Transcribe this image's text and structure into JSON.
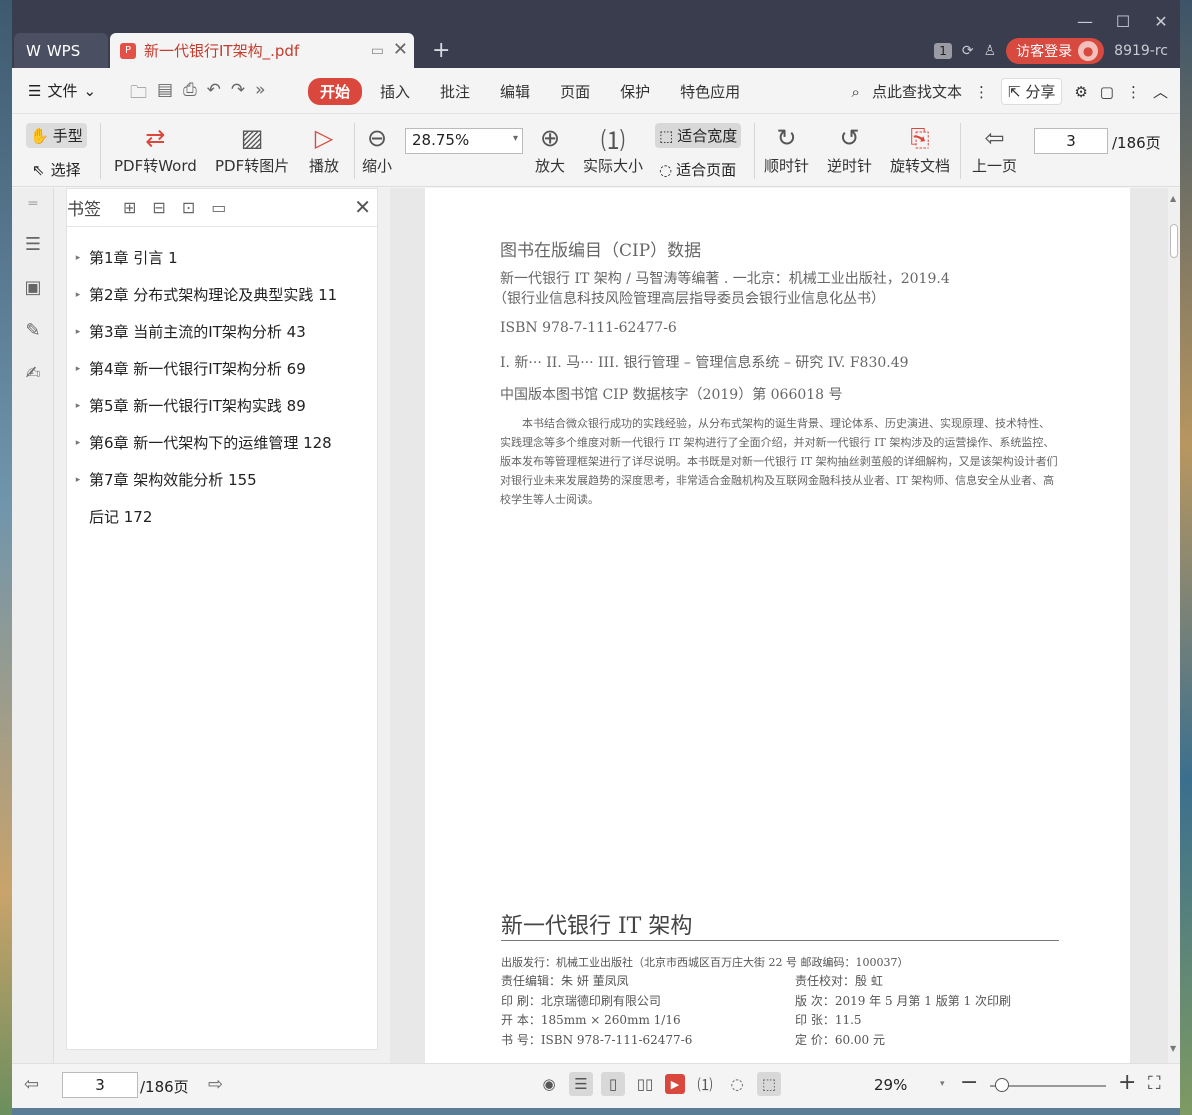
{
  "titlebar": {
    "app_tab": "WPS",
    "doc_tab": "新一代银行IT架构_.pdf",
    "login_label": "访客登录",
    "user_tag": "8919-rc",
    "badge": "1"
  },
  "menubar": {
    "file": "文件",
    "tabs": [
      "开始",
      "插入",
      "批注",
      "编辑",
      "页面",
      "保护",
      "特色应用"
    ],
    "search_label": "点此查找文本",
    "share_label": "分享"
  },
  "toolbar": {
    "hand": "手型",
    "select": "选择",
    "pdf_to_word": "PDF转Word",
    "pdf_to_image": "PDF转图片",
    "play": "播放",
    "zoom_out": "缩小",
    "zoom_value": "28.75%",
    "zoom_in": "放大",
    "actual_size": "实际大小",
    "fit_width": "适合宽度",
    "fit_page": "适合页面",
    "rotate_cw": "顺时针",
    "rotate_ccw": "逆时针",
    "rotate_doc": "旋转文档",
    "prev_page": "上一页",
    "page_input": "3",
    "page_total": "/186页"
  },
  "bookmarks": {
    "title": "书签",
    "items": [
      {
        "label": "第1章   引言  1",
        "expandable": true
      },
      {
        "label": "第2章   分布式架构理论及典型实践  11",
        "expandable": true
      },
      {
        "label": "第3章   当前主流的IT架构分析  43",
        "expandable": true
      },
      {
        "label": "第4章   新一代银行IT架构分析  69",
        "expandable": true
      },
      {
        "label": "第5章   新一代银行IT架构实践  89",
        "expandable": true
      },
      {
        "label": "第6章   新一代架构下的运维管理  128",
        "expandable": true
      },
      {
        "label": "第7章   架构效能分析  155",
        "expandable": true
      },
      {
        "label": "后记  172",
        "expandable": false
      }
    ]
  },
  "page": {
    "cip_title": "图书在版编目（CIP）数据",
    "line1": "新一代银行 IT 架构 / 马智涛等编著 . 一北京：机械工业出版社，2019.4",
    "line2": "（银行业信息科技风险管理高层指导委员会银行业信息化丛书）",
    "isbn": "ISBN 978-7-111-62477-6",
    "classification": "I. 新···   II. 马···   III. 银行管理 – 管理信息系统 – 研究   IV. F830.49",
    "cip_number": "中国版本图书馆 CIP 数据核字（2019）第 066018 号",
    "summary": "本书结合微众银行成功的实践经验，从分布式架构的诞生背景、理论体系、历史演进、实现原理、技术特性、实践理念等多个维度对新一代银行 IT 架构进行了全面介绍，并对新一代银行 IT 架构涉及的运营操作、系统监控、版本发布等管理框架进行了详尽说明。本书既是对新一代银行 IT 架构抽丝剥茧般的详细解构，又是该架构设计者们对银行业未来发展趋势的深度思考，非常适合金融机构及互联网金融科技从业者、IT 架构师、信息安全从业者、高校学生等人士阅读。",
    "book_title": "新一代银行 IT 架构",
    "publisher": "出版发行：机械工业出版社（北京市西城区百万庄大街 22 号   邮政编码：100037）",
    "left_col": [
      "责任编辑：朱   妍      董凤凤",
      "印      刷：北京瑞德印刷有限公司",
      "开      本：185mm × 260mm   1/16",
      "书      号：ISBN 978-7-111-62477-6"
    ],
    "right_col": [
      "责任校对：殷   虹",
      "版      次：2019 年 5 月第 1 版第 1 次印刷",
      "印      张：11.5",
      "定      价：60.00 元"
    ]
  },
  "statusbar": {
    "page_input": "3",
    "page_total": "/186页",
    "zoom": "29%",
    "zoom_level_fraction": 0.1
  },
  "colors": {
    "accent": "#d9473d",
    "titlebar": "#3a3d4e"
  }
}
